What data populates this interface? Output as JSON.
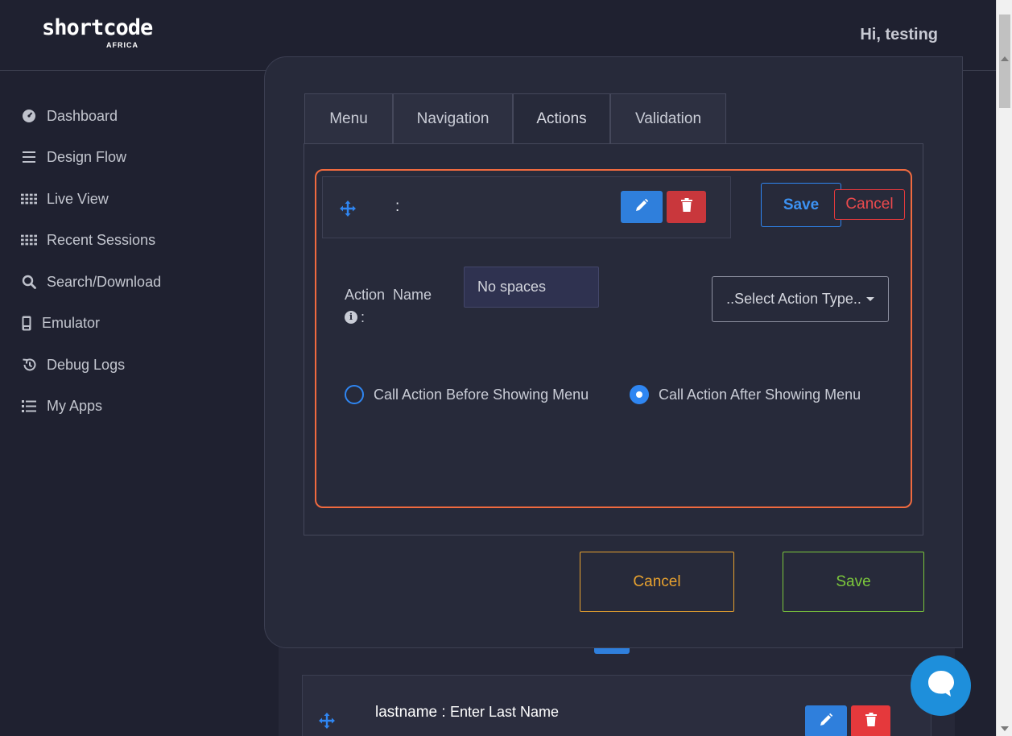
{
  "header": {
    "logo_text": "shortcode",
    "logo_sub": "AFRICA",
    "greeting": "Hi, testing"
  },
  "sidebar": {
    "items": [
      {
        "label": "Dashboard",
        "icon": "gauge-icon"
      },
      {
        "label": "Design Flow",
        "icon": "bars-icon"
      },
      {
        "label": "Live View",
        "icon": "grid-dots-icon"
      },
      {
        "label": "Recent Sessions",
        "icon": "grid-dots-icon"
      },
      {
        "label": "Search/Download",
        "icon": "search-icon"
      },
      {
        "label": "Emulator",
        "icon": "mobile-icon"
      },
      {
        "label": "Debug Logs",
        "icon": "history-icon"
      },
      {
        "label": "My Apps",
        "icon": "list-icon"
      }
    ]
  },
  "modal": {
    "tabs": [
      {
        "label": "Menu",
        "active": false
      },
      {
        "label": "Navigation",
        "active": false
      },
      {
        "label": "Actions",
        "active": true
      },
      {
        "label": "Validation",
        "active": false
      }
    ],
    "action_item": {
      "text": ":",
      "save_label": "Save",
      "cancel_label": "Cancel"
    },
    "action_name": {
      "label": "Action  Name",
      "suffix": ":",
      "placeholder": "No spaces",
      "value": ""
    },
    "action_type": {
      "selected": "..Select Action Type.."
    },
    "timing": {
      "before_label": "Call Action Before Showing Menu",
      "after_label": "Call Action After Showing Menu",
      "selected": "after"
    },
    "footer": {
      "cancel_label": "Cancel",
      "save_label": "Save"
    }
  },
  "background_item": {
    "name": "lastname",
    "separator": " : ",
    "text": "Enter Last Name"
  },
  "colors": {
    "accent_blue": "#2f86f2",
    "danger_red": "#e5393c",
    "warning_orange": "#e8a22f",
    "success_green": "#7bc73c",
    "highlight_border": "#f06a3f",
    "background": "#1f2130"
  }
}
